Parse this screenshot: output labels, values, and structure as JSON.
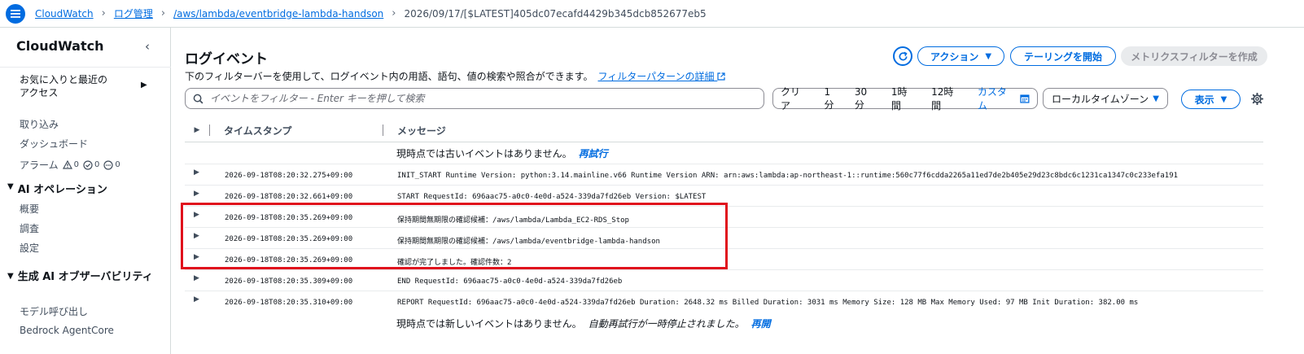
{
  "breadcrumbs": {
    "items": [
      "CloudWatch",
      "ログ管理",
      "/aws/lambda/eventbridge-lambda-handson"
    ],
    "current": "2026/09/17/[$LATEST]405dc07ecafd4429b345dcb852677eb5"
  },
  "sidebar": {
    "title": "CloudWatch",
    "favorites_label": "お気に入りと最近の\nアクセス",
    "items_top": [
      "取り込み",
      "ダッシュボード"
    ],
    "alarm": {
      "label": "アラーム",
      "counts": [
        "0",
        "0",
        "0"
      ]
    },
    "section_ai_ops": {
      "title": "AI オペレーション",
      "items": [
        "概要",
        "調査",
        "設定"
      ]
    },
    "section_genai": {
      "title": "生成 AI オブザーバビリティ",
      "items": [
        "モデル呼び出し",
        "Bedrock AgentCore"
      ]
    }
  },
  "header": {
    "title": "ログイベント",
    "description": "下のフィルターバーを使用して、ログイベント内の用語、語句、値の検索や照合ができます。",
    "link": "フィルターパターンの詳細",
    "buttons": {
      "actions": "アクション",
      "tailing": "テーリングを開始",
      "metric_filter": "メトリクスフィルターを作成"
    }
  },
  "filter": {
    "placeholder": "イベントをフィルター - Enter キーを押して検索",
    "ranges": [
      "クリア",
      "1分",
      "30分",
      "1時間",
      "12時間",
      "カスタム"
    ],
    "timezone": "ローカルタイムゾーン",
    "display": "表示"
  },
  "table": {
    "col_timestamp": "タイムスタンプ",
    "col_message": "メッセージ",
    "top_notice": "現時点では古いイベントはありません。",
    "top_action": "再試行",
    "bottom_notice": "現時点では新しいイベントはありません。",
    "bottom_paused": "自動再試行が一時停止されました。",
    "bottom_action": "再開",
    "rows": [
      {
        "ts": "2026-09-18T08:20:32.275+09:00",
        "msg": "INIT_START Runtime Version: python:3.14.mainline.v66 Runtime Version ARN: arn:aws:lambda:ap-northeast-1::runtime:560c77f6cdda2265a11ed7de2b405e29d23c8bdc6c1231ca1347c0c233efa191"
      },
      {
        "ts": "2026-09-18T08:20:32.661+09:00",
        "msg": "START RequestId: 696aac75-a0c0-4e0d-a524-339da7fd26eb Version: $LATEST"
      },
      {
        "ts": "2026-09-18T08:20:35.269+09:00",
        "msg": "保持期間無期限の確認候補：/aws/lambda/Lambda_EC2-RDS_Stop"
      },
      {
        "ts": "2026-09-18T08:20:35.269+09:00",
        "msg": "保持期間無期限の確認候補：/aws/lambda/eventbridge-lambda-handson"
      },
      {
        "ts": "2026-09-18T08:20:35.269+09:00",
        "msg": "確認が完了しました。確認件数：2"
      },
      {
        "ts": "2026-09-18T08:20:35.309+09:00",
        "msg": "END RequestId: 696aac75-a0c0-4e0d-a524-339da7fd26eb"
      },
      {
        "ts": "2026-09-18T08:20:35.310+09:00",
        "msg": "REPORT RequestId: 696aac75-a0c0-4e0d-a524-339da7fd26eb Duration: 2648.32 ms Billed Duration: 3031 ms Memory Size: 128 MB Max Memory Used: 97 MB Init Duration: 382.00 ms"
      }
    ]
  },
  "colors": {
    "accent": "#006ce0",
    "highlight": "#e0101c",
    "text": "#0f141a"
  }
}
